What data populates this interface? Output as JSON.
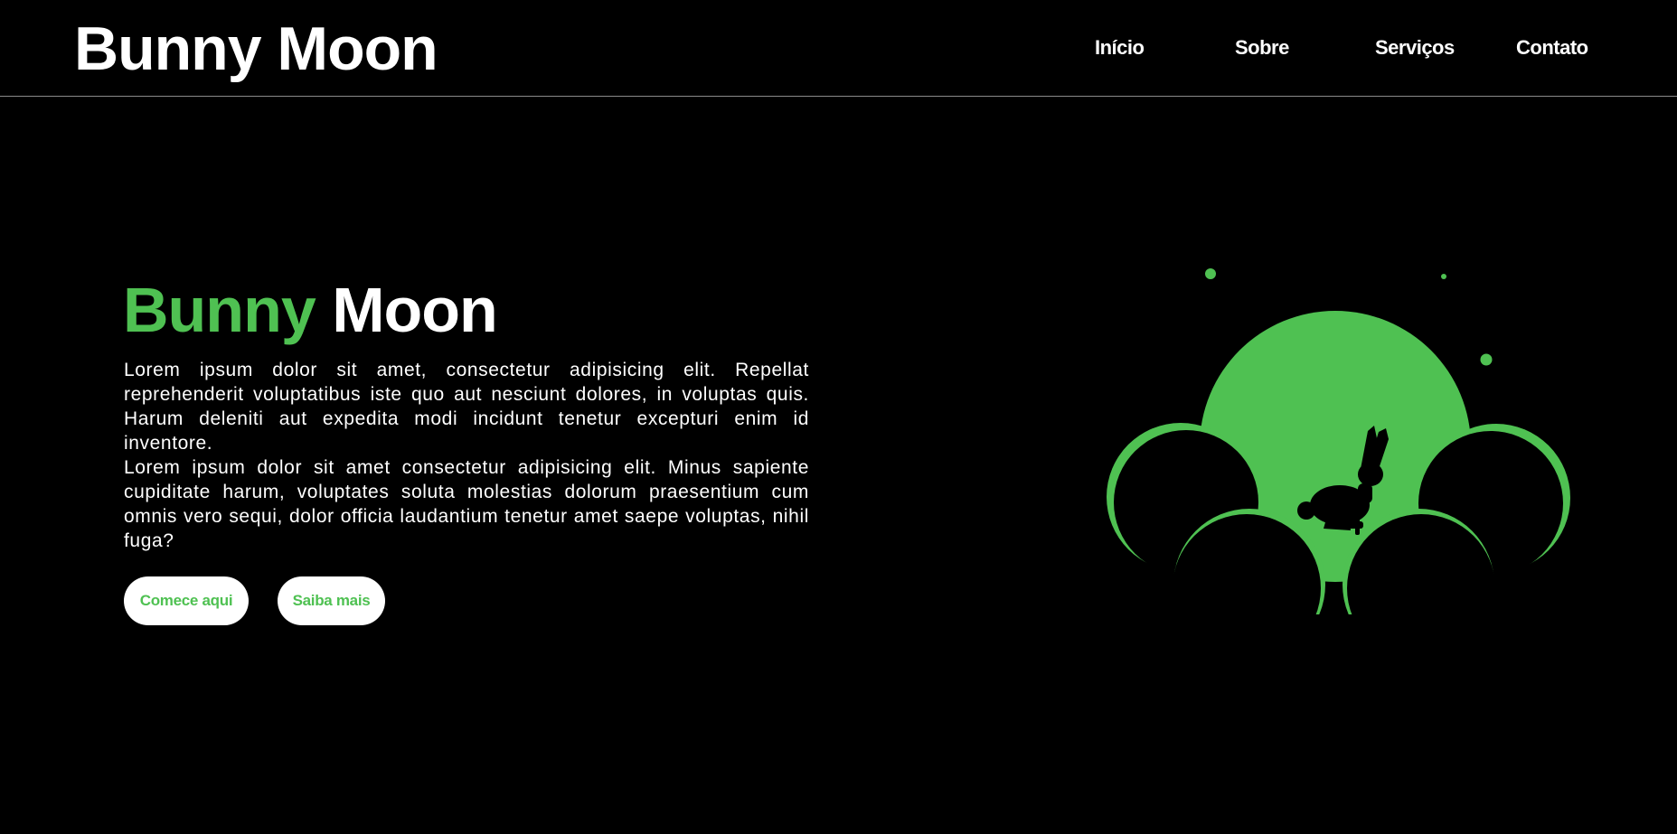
{
  "header": {
    "brand": "Bunny Moon",
    "nav": [
      "Início",
      "Sobre",
      "Serviços",
      "Contato"
    ]
  },
  "hero": {
    "title_accent": "Bunny",
    "title_rest": "Moon",
    "paragraph_1": "Lorem ipsum dolor sit amet, consectetur adipisicing elit. Repellat reprehenderit voluptatibus iste quo aut nesciunt dolores, in voluptas quis. Harum deleniti aut expedita modi incidunt tenetur excepturi enim id inventore.",
    "paragraph_2": "Lorem ipsum dolor sit amet consectetur adipisicing elit. Minus sapiente cupiditate harum, voluptates soluta molestias dolorum praesentium cum omnis vero sequi, dolor officia laudantium tenetur amet saepe voluptas, nihil fuga?",
    "button_primary": "Comece aqui",
    "button_secondary": "Saiba mais"
  },
  "colors": {
    "background": "#000000",
    "accent": "#4fc152",
    "text": "#ffffff"
  },
  "illustration": {
    "icon": "bunny-moon-illustration"
  }
}
